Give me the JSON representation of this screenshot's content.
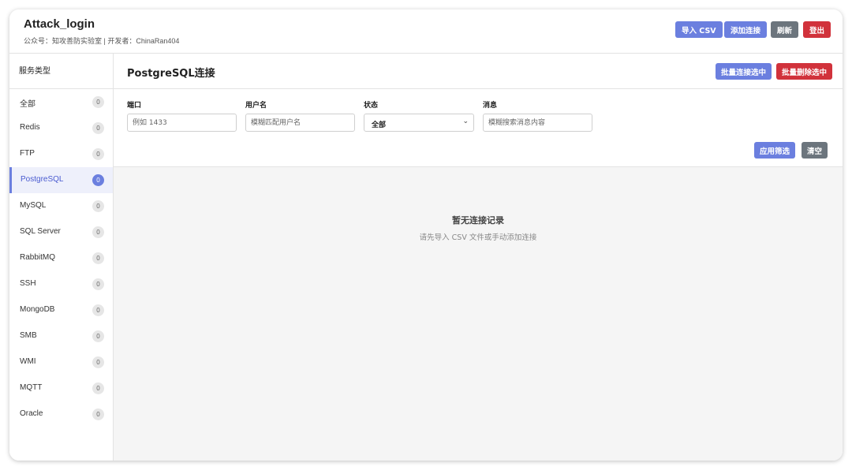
{
  "header": {
    "title": "Attack_login",
    "subtitle": "公众号：知攻善防实验室 | 开发者：ChinaRan404",
    "buttons": {
      "import_csv": "导入 CSV",
      "add_connection": "添加连接",
      "refresh": "刷新",
      "logout": "登出"
    }
  },
  "sidebar": {
    "title": "服务类型",
    "items": [
      {
        "label": "全部",
        "count": "0"
      },
      {
        "label": "Redis",
        "count": "0"
      },
      {
        "label": "FTP",
        "count": "0"
      },
      {
        "label": "PostgreSQL",
        "count": "0"
      },
      {
        "label": "MySQL",
        "count": "0"
      },
      {
        "label": "SQL Server",
        "count": "0"
      },
      {
        "label": "RabbitMQ",
        "count": "0"
      },
      {
        "label": "SSH",
        "count": "0"
      },
      {
        "label": "MongoDB",
        "count": "0"
      },
      {
        "label": "SMB",
        "count": "0"
      },
      {
        "label": "WMI",
        "count": "0"
      },
      {
        "label": "MQTT",
        "count": "0"
      },
      {
        "label": "Oracle",
        "count": "0"
      }
    ],
    "active_index": 3
  },
  "main": {
    "title": "PostgreSQL连接",
    "batch_connect_label": "批量连接选中",
    "batch_delete_label": "批量删除选中",
    "filters": {
      "port_label": "端口",
      "port_placeholder": "例如 1433",
      "username_label": "用户名",
      "username_placeholder": "模糊匹配用户名",
      "status_label": "状态",
      "status_value": "全部",
      "message_label": "消息",
      "message_placeholder": "模糊搜索消息内容",
      "apply_label": "应用筛选",
      "clear_label": "清空"
    },
    "empty": {
      "title": "暂无连接记录",
      "subtitle": "请先导入 CSV 文件或手动添加连接"
    }
  },
  "colors": {
    "primary": "#6b7fdf",
    "secondary": "#6c757d",
    "danger": "#d1323b"
  }
}
